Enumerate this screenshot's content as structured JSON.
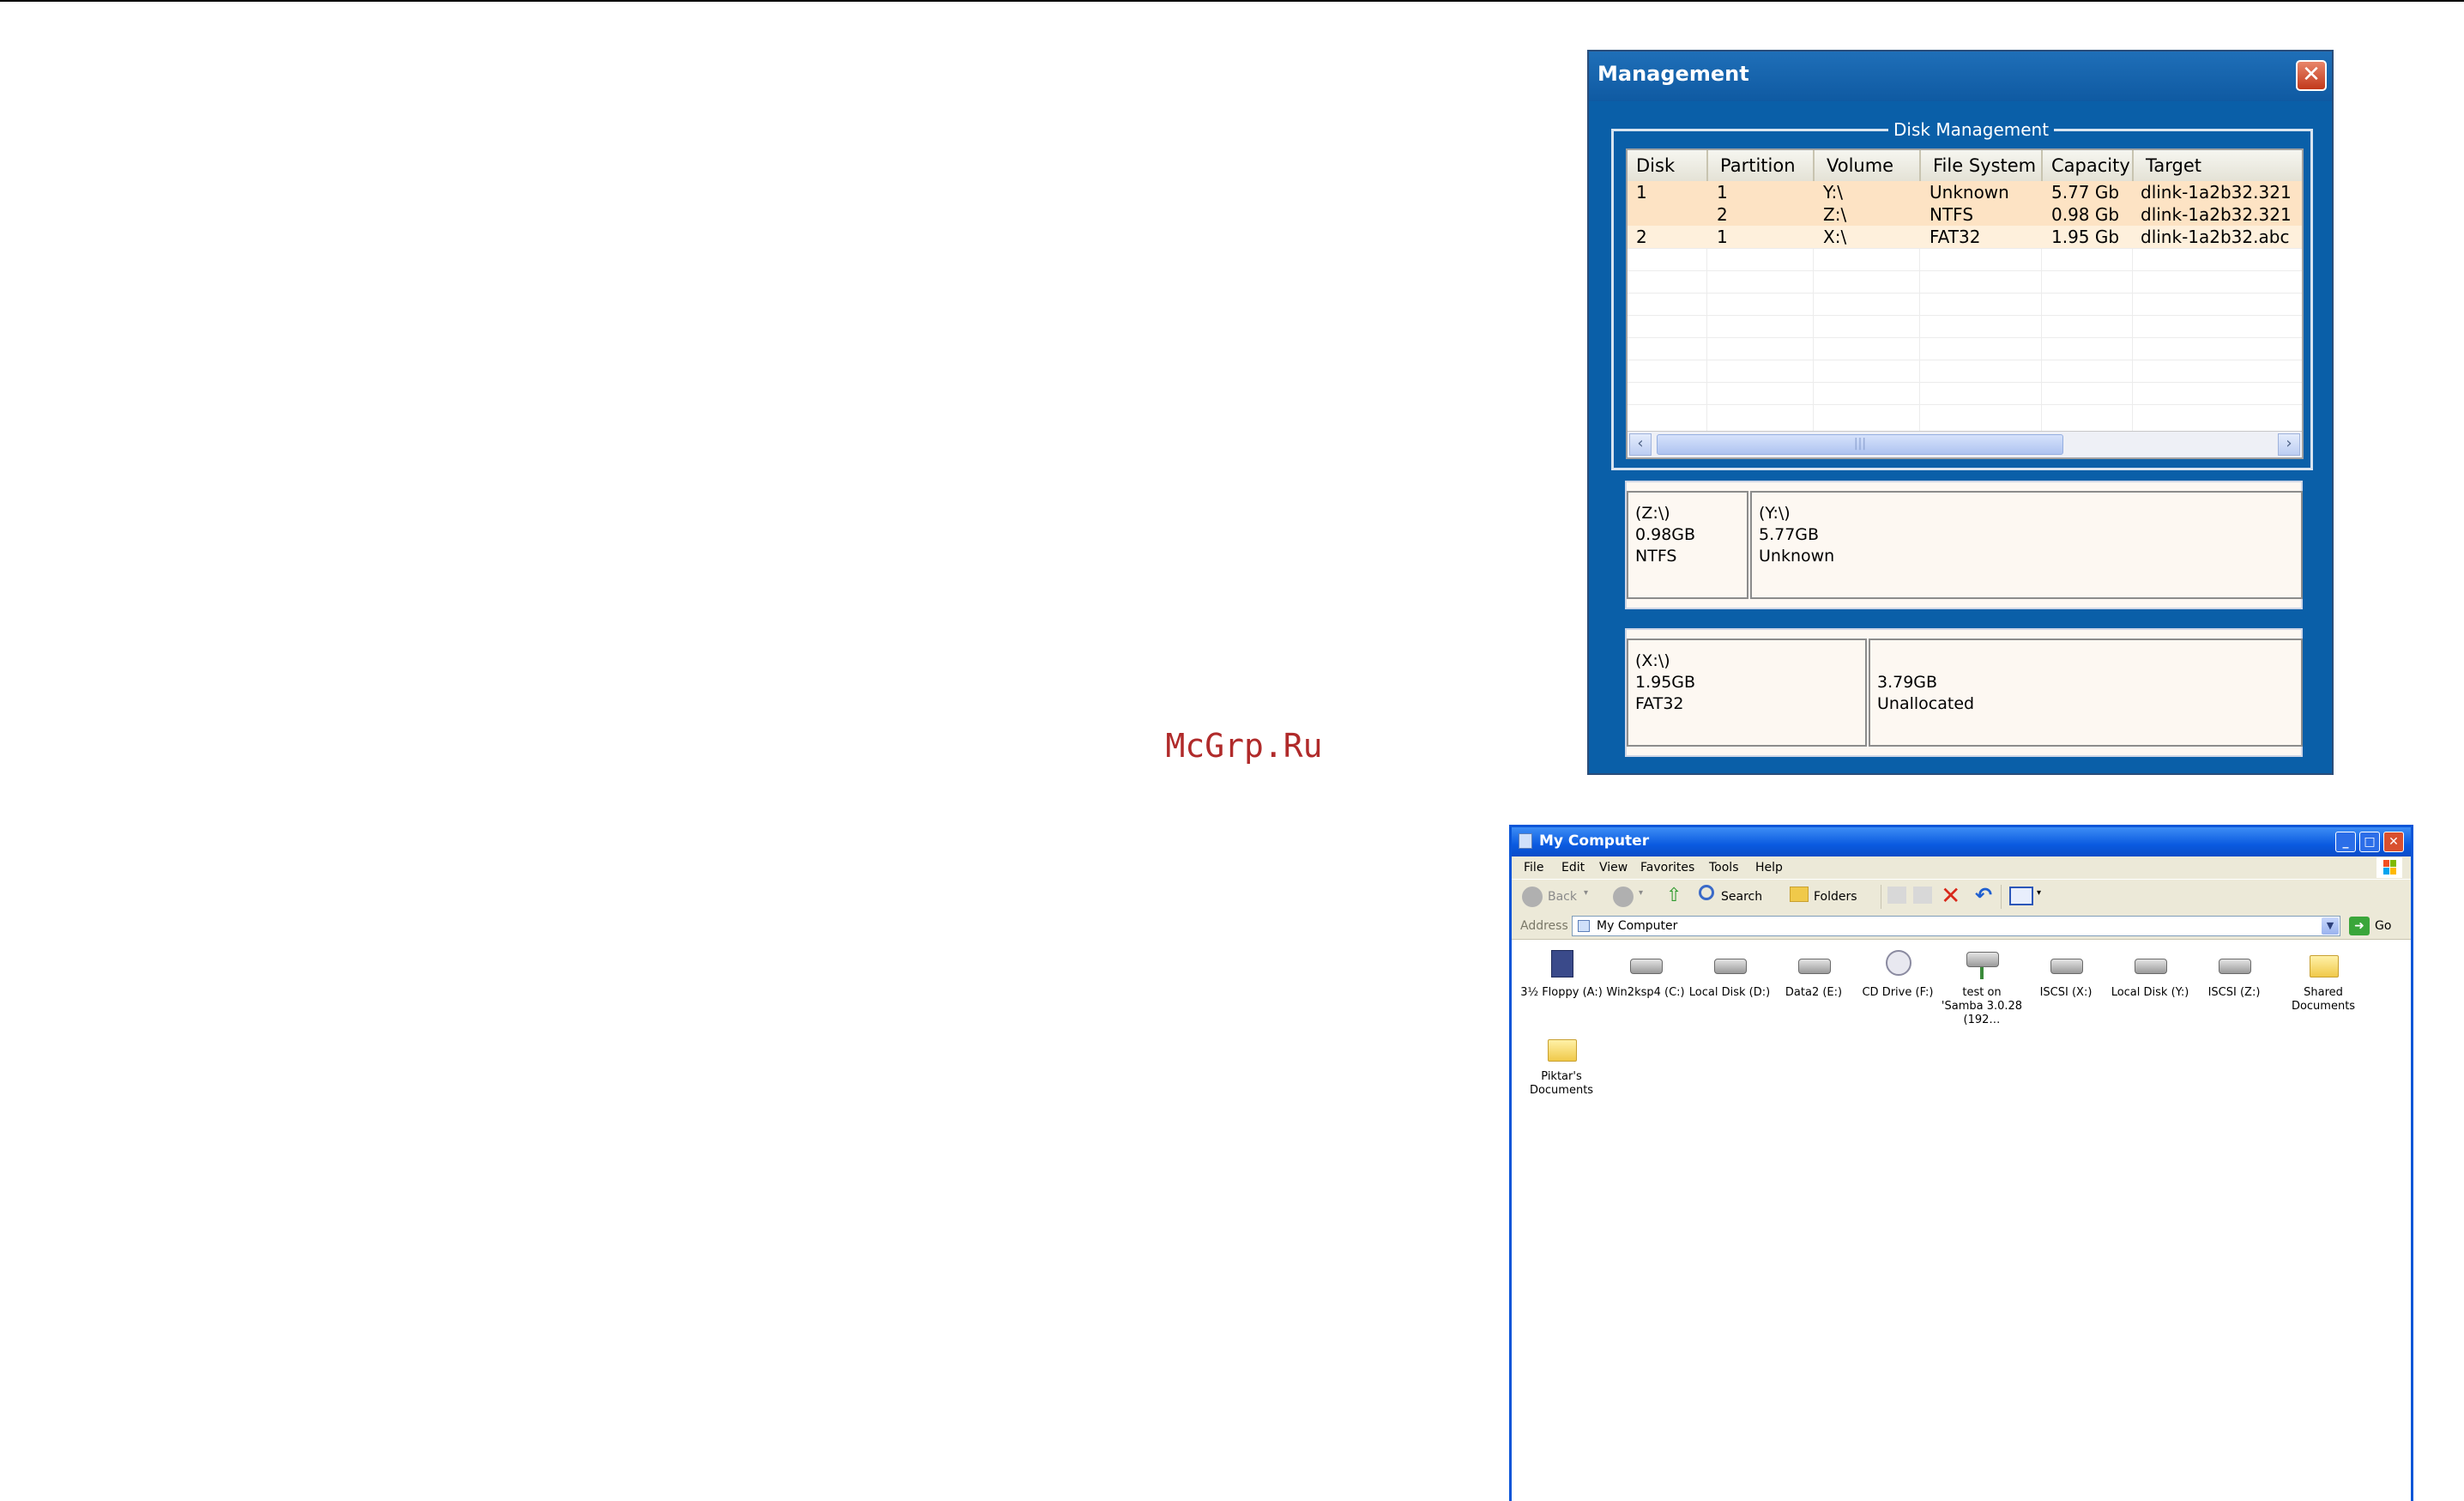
{
  "watermark": "McGrp.Ru",
  "management": {
    "title": "Management",
    "group_label": "Disk Management",
    "columns": [
      "Disk",
      "Partition",
      "Volume",
      "File System",
      "Capacity",
      "Target"
    ],
    "rows": [
      {
        "disk": "1",
        "partition": "1",
        "volume": "Y:\\",
        "fs": "Unknown",
        "capacity": "5.77 Gb",
        "target": "dlink-1a2b32.321"
      },
      {
        "disk": "",
        "partition": "2",
        "volume": "Z:\\",
        "fs": "NTFS",
        "capacity": "0.98 Gb",
        "target": "dlink-1a2b32.321"
      },
      {
        "disk": "2",
        "partition": "1",
        "volume": "X:\\",
        "fs": "FAT32",
        "capacity": "1.95 Gb",
        "target": "dlink-1a2b32.abc"
      }
    ],
    "disk1_partitions": [
      {
        "lines": [
          "(Z:\\)",
          "0.98GB",
          "NTFS"
        ]
      },
      {
        "lines": [
          "(Y:\\)",
          "5.77GB",
          "Unknown"
        ]
      }
    ],
    "disk2_partitions": [
      {
        "lines": [
          "(X:\\)",
          "1.95GB",
          "FAT32"
        ]
      },
      {
        "lines": [
          "",
          "3.79GB",
          "Unallocated"
        ]
      }
    ],
    "colors": {
      "window_bg": "#0a5fa8",
      "row_highlight": "#fde3c4",
      "row_alt": "#fef0dc"
    }
  },
  "explorer": {
    "title": "My Computer",
    "menu": [
      "File",
      "Edit",
      "View",
      "Favorites",
      "Tools",
      "Help"
    ],
    "toolbar": {
      "back": "Back",
      "search": "Search",
      "folders": "Folders"
    },
    "address_label": "Address",
    "address_value": "My Computer",
    "go_label": "Go",
    "items": [
      {
        "label": "3½ Floppy (A:)",
        "icon": "floppy-icon"
      },
      {
        "label": "Win2ksp4 (C:)",
        "icon": "drive-icon"
      },
      {
        "label": "Local Disk (D:)",
        "icon": "drive-icon"
      },
      {
        "label": "Data2 (E:)",
        "icon": "drive-icon"
      },
      {
        "label": "CD Drive (F:)",
        "icon": "cd-icon"
      },
      {
        "label": "test on 'Samba 3.0.28 (192…",
        "icon": "network-drive-icon"
      },
      {
        "label": "ISCSI (X:)",
        "icon": "drive-icon"
      },
      {
        "label": "Local Disk (Y:)",
        "icon": "drive-icon"
      },
      {
        "label": "ISCSI (Z:)",
        "icon": "drive-icon"
      },
      {
        "label": "Shared Documents",
        "icon": "folder-icon"
      },
      {
        "label": "Piktar's Documents",
        "icon": "folder-icon"
      }
    ]
  }
}
